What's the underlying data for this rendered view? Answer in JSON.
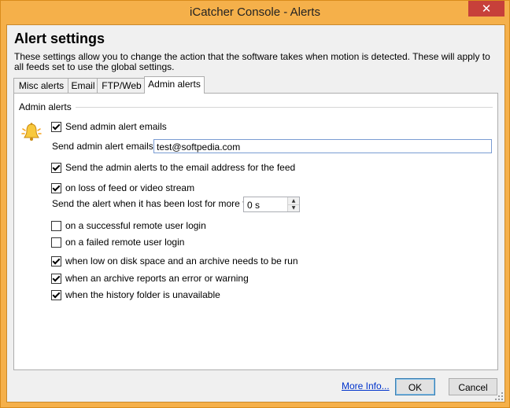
{
  "window": {
    "title": "iCatcher Console - Alerts",
    "close_glyph": "✕"
  },
  "header": {
    "heading": "Alert settings",
    "description": "These settings allow you to change the action that the software takes when motion is detected. These will apply to all feeds set to use the global settings."
  },
  "tabs": [
    {
      "label": "Misc alerts",
      "active": false
    },
    {
      "label": "Email",
      "active": false
    },
    {
      "label": "FTP/Web",
      "active": false
    },
    {
      "label": "Admin alerts",
      "active": true
    }
  ],
  "admin": {
    "group_label": "Admin alerts",
    "bell_icon": "bell-icon",
    "send_emails": {
      "label": "Send admin alert emails",
      "checked": true
    },
    "emails_to_label": "Send admin alert emails to",
    "emails_to_value": "test@softpedia.com",
    "feed_address": {
      "label": "Send the admin alerts to the email address for the feed",
      "checked": true
    },
    "loss_of_feed": {
      "label": "on loss of feed or video stream",
      "checked": true
    },
    "lost_for_label": "Send the alert when it has been lost for more than",
    "lost_for_value": "0 s",
    "remote_success": {
      "label": "on a successful remote user login",
      "checked": false
    },
    "remote_failed": {
      "label": "on a failed remote user login",
      "checked": false
    },
    "low_disk": {
      "label": "when low on disk space and an archive needs to be run",
      "checked": true
    },
    "archive_error": {
      "label": "when an archive reports an error or warning",
      "checked": true
    },
    "history_unavailable": {
      "label": "when the history folder is unavailable",
      "checked": true
    }
  },
  "footer": {
    "more_info": "More Info...",
    "ok": "OK",
    "cancel": "Cancel"
  },
  "colors": {
    "title_bar": "#f5b04a",
    "close_button": "#c7403a",
    "link": "#0033cc"
  }
}
